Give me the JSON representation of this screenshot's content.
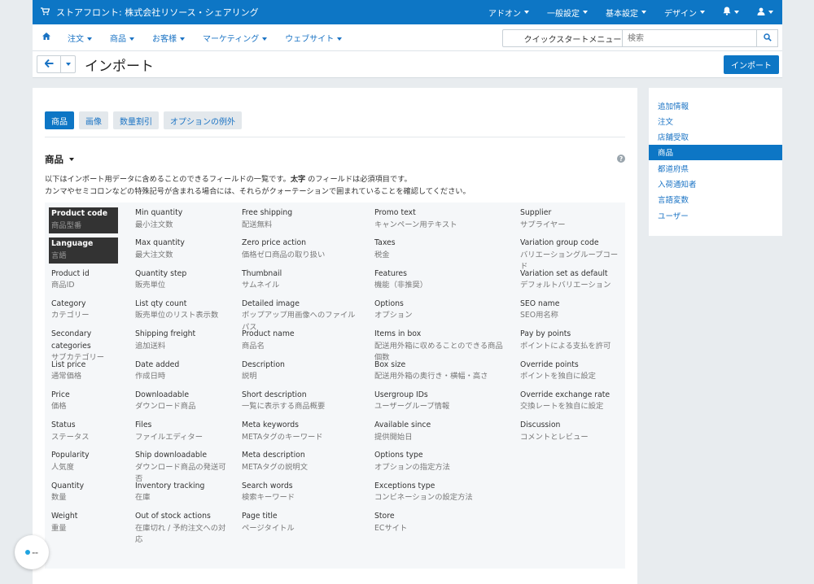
{
  "topbar": {
    "store_title": "ストアフロント: 株式会社リソース・シェアリング",
    "menus": [
      "アドオン",
      "一般設定",
      "基本設定",
      "デザイン"
    ]
  },
  "subnav": {
    "items": [
      "注文",
      "商品",
      "お客様",
      "マーケティング",
      "ウェブサイト"
    ],
    "quickstart": "クイックスタートメニュー",
    "search_placeholder": "検索"
  },
  "page": {
    "title": "インポート",
    "import_button": "インポート"
  },
  "tabs": [
    "商品",
    "画像",
    "数量割引",
    "オプションの例外"
  ],
  "section": {
    "title": "商品",
    "desc_line1_pre": "以下はインポート用データに含めることのできるフィールドの一覧です。",
    "desc_bold": "太字",
    "desc_line1_post": "のフィールドは必須項目です。",
    "desc_line2": "カンマやセミコロンなどの特殊記号が含まれる場合には、それらがクォーテーションで囲まれていることを確認してください。"
  },
  "fields": {
    "col1": [
      {
        "en": "Product code",
        "jp": "商品型番",
        "required": true
      },
      {
        "en": "Language",
        "jp": "言語",
        "required": true
      },
      {
        "en": "Product id",
        "jp": "商品ID"
      },
      {
        "en": "Category",
        "jp": "カテゴリー"
      },
      {
        "en": "Secondary categories",
        "jp": "サブカテゴリー"
      },
      {
        "en": "List price",
        "jp": "通常価格"
      },
      {
        "en": "Price",
        "jp": "価格"
      },
      {
        "en": "Status",
        "jp": "ステータス"
      },
      {
        "en": "Popularity",
        "jp": "人気度"
      },
      {
        "en": "Quantity",
        "jp": "数量"
      },
      {
        "en": "Weight",
        "jp": "重量"
      }
    ],
    "col2": [
      {
        "en": "Min quantity",
        "jp": "最小注文数"
      },
      {
        "en": "Max quantity",
        "jp": "最大注文数"
      },
      {
        "en": "Quantity step",
        "jp": "販売単位"
      },
      {
        "en": "List qty count",
        "jp": "販売単位のリスト表示数"
      },
      {
        "en": "Shipping freight",
        "jp": "追加送料"
      },
      {
        "en": "Date added",
        "jp": "作成日時"
      },
      {
        "en": "Downloadable",
        "jp": "ダウンロード商品"
      },
      {
        "en": "Files",
        "jp": "ファイルエディター"
      },
      {
        "en": "Ship downloadable",
        "jp": "ダウンロード商品の発送可否"
      },
      {
        "en": "Inventory tracking",
        "jp": "在庫"
      },
      {
        "en": "Out of stock actions",
        "jp": "在庫切れ / 予約注文への対応"
      }
    ],
    "col3": [
      {
        "en": "Free shipping",
        "jp": "配送無料"
      },
      {
        "en": "Zero price action",
        "jp": "価格ゼロ商品の取り扱い"
      },
      {
        "en": "Thumbnail",
        "jp": "サムネイル"
      },
      {
        "en": "Detailed image",
        "jp": "ポップアップ用画像へのファイルパス"
      },
      {
        "en": "Product name",
        "jp": "商品名"
      },
      {
        "en": "Description",
        "jp": "説明"
      },
      {
        "en": "Short description",
        "jp": "一覧に表示する商品概要"
      },
      {
        "en": "Meta keywords",
        "jp": "METAタグのキーワード"
      },
      {
        "en": "Meta description",
        "jp": "METAタグの説明文"
      },
      {
        "en": "Search words",
        "jp": "検索キーワード"
      },
      {
        "en": "Page title",
        "jp": "ページタイトル"
      }
    ],
    "col4": [
      {
        "en": "Promo text",
        "jp": "キャンペーン用テキスト"
      },
      {
        "en": "Taxes",
        "jp": "税金"
      },
      {
        "en": "Features",
        "jp": "機能（非推奨）"
      },
      {
        "en": "Options",
        "jp": "オプション"
      },
      {
        "en": "Items in box",
        "jp": "配送用外箱に収めることのできる商品個数"
      },
      {
        "en": "Box size",
        "jp": "配送用外箱の奥行き・横幅・高さ"
      },
      {
        "en": "Usergroup IDs",
        "jp": "ユーザーグループ情報"
      },
      {
        "en": "Available since",
        "jp": "提供開始日"
      },
      {
        "en": "Options type",
        "jp": "オプションの指定方法"
      },
      {
        "en": "Exceptions type",
        "jp": "コンビネーションの設定方法"
      },
      {
        "en": "Store",
        "jp": "ECサイト"
      }
    ],
    "col5": [
      {
        "en": "Supplier",
        "jp": "サプライヤー"
      },
      {
        "en": "Variation group code",
        "jp": "バリエーショングループコード"
      },
      {
        "en": "Variation set as default",
        "jp": "デフォルトバリエーション"
      },
      {
        "en": "SEO name",
        "jp": "SEO用名称"
      },
      {
        "en": "Pay by points",
        "jp": "ポイントによる支払を許可"
      },
      {
        "en": "Override points",
        "jp": "ポイントを独自に設定"
      },
      {
        "en": "Override exchange rate",
        "jp": "交換レートを独自に設定"
      },
      {
        "en": "Discussion",
        "jp": "コメントとレビュー"
      }
    ]
  },
  "sidebar": {
    "items": [
      "追加情報",
      "注文",
      "店舗受取",
      "商品",
      "都道府県",
      "入荷通知者",
      "言語変数",
      "ユーザー"
    ],
    "active_index": 3
  },
  "colors": {
    "brand_blue": "#0d76c5",
    "link_blue": "#1a73c4"
  }
}
